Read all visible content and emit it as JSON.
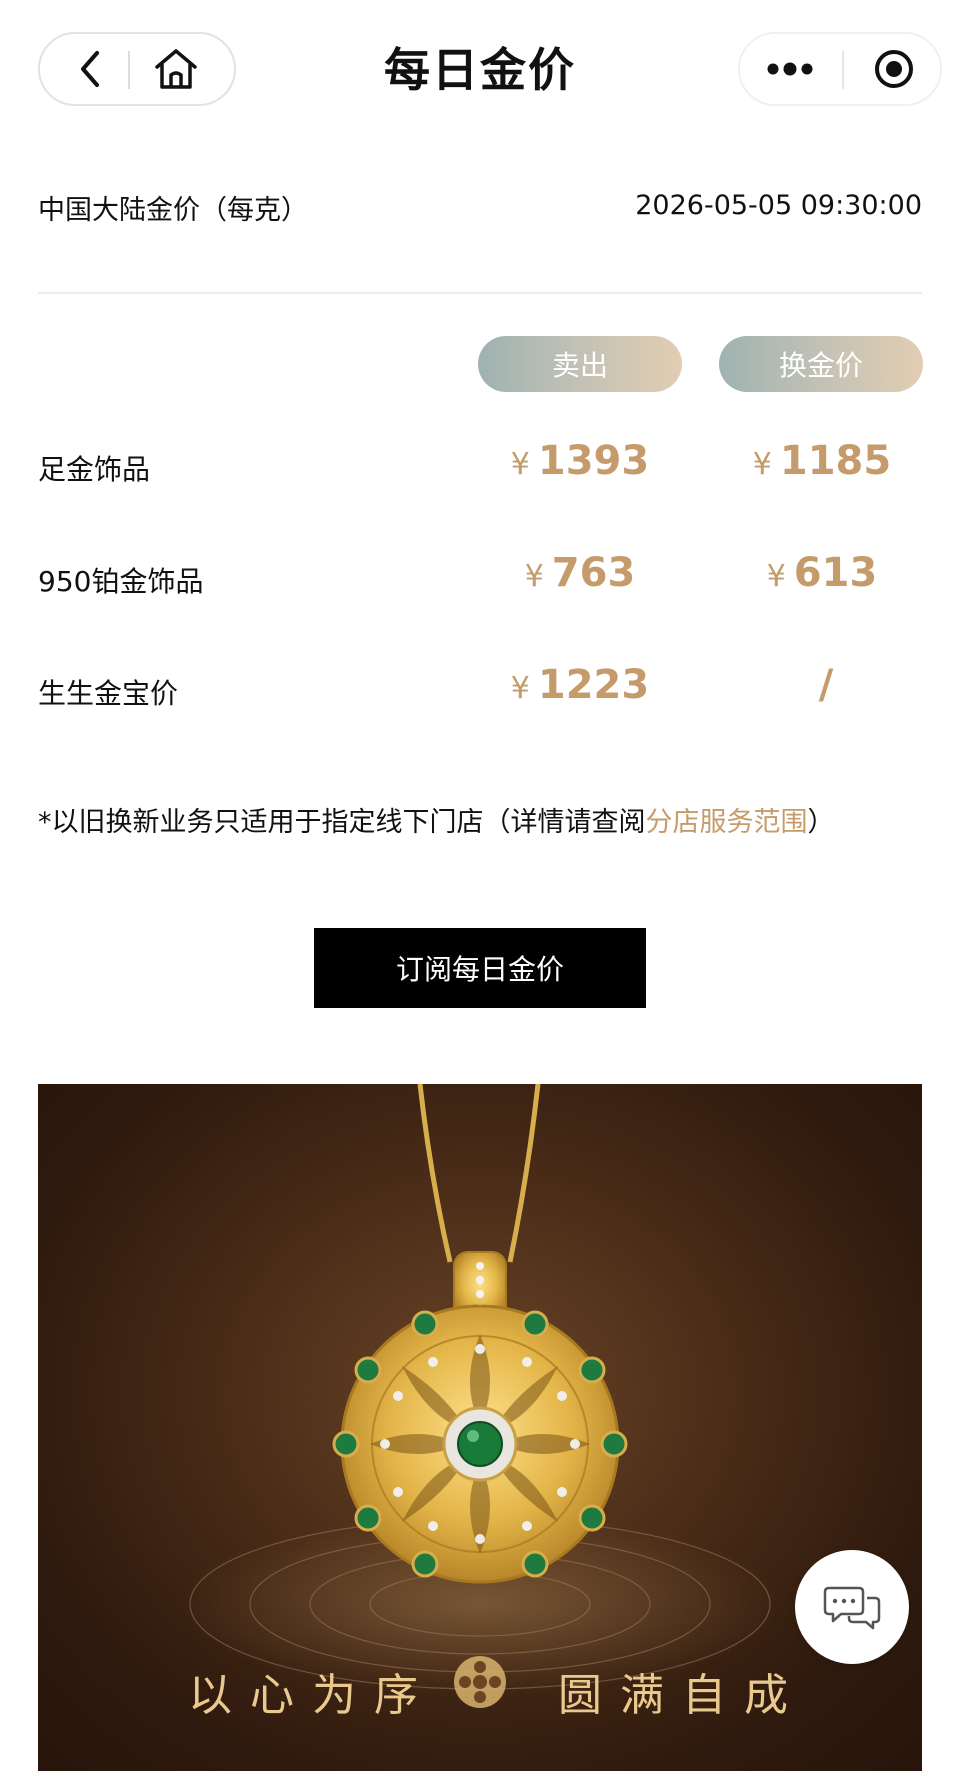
{
  "nav": {
    "title": "每日金价",
    "icons": [
      "back-arrow-icon",
      "home-icon",
      "more-dots-icon",
      "target-icon"
    ]
  },
  "header": {
    "region_label": "中国大陆金价（每克）",
    "update_time": "2026-05-05 09:30:00"
  },
  "columns": {
    "sell": "卖出",
    "exchange": "换金价"
  },
  "rows": [
    {
      "name": "足金饰品",
      "sell": "1393",
      "exchange": "1185",
      "exchange_currency": "¥"
    },
    {
      "name": "950铂金饰品",
      "sell": "763",
      "exchange": "613",
      "exchange_currency": "¥"
    },
    {
      "name": "生生金宝价",
      "sell": "1223",
      "exchange": "/",
      "exchange_currency": ""
    }
  ],
  "currency": "¥",
  "note": {
    "prefix": "*以旧换新业务只适用于指定线下门店（详情请查阅",
    "link": "分店服务范围",
    "suffix": "）"
  },
  "subscribe_label": "订阅每日金价",
  "banner": {
    "slogan_left": "以心为序",
    "slogan_right": "圆满自成"
  },
  "colors": {
    "accent_gold": "#c59b6b",
    "pill_start": "#9fb2b1",
    "pill_end": "#e2cdb2"
  }
}
